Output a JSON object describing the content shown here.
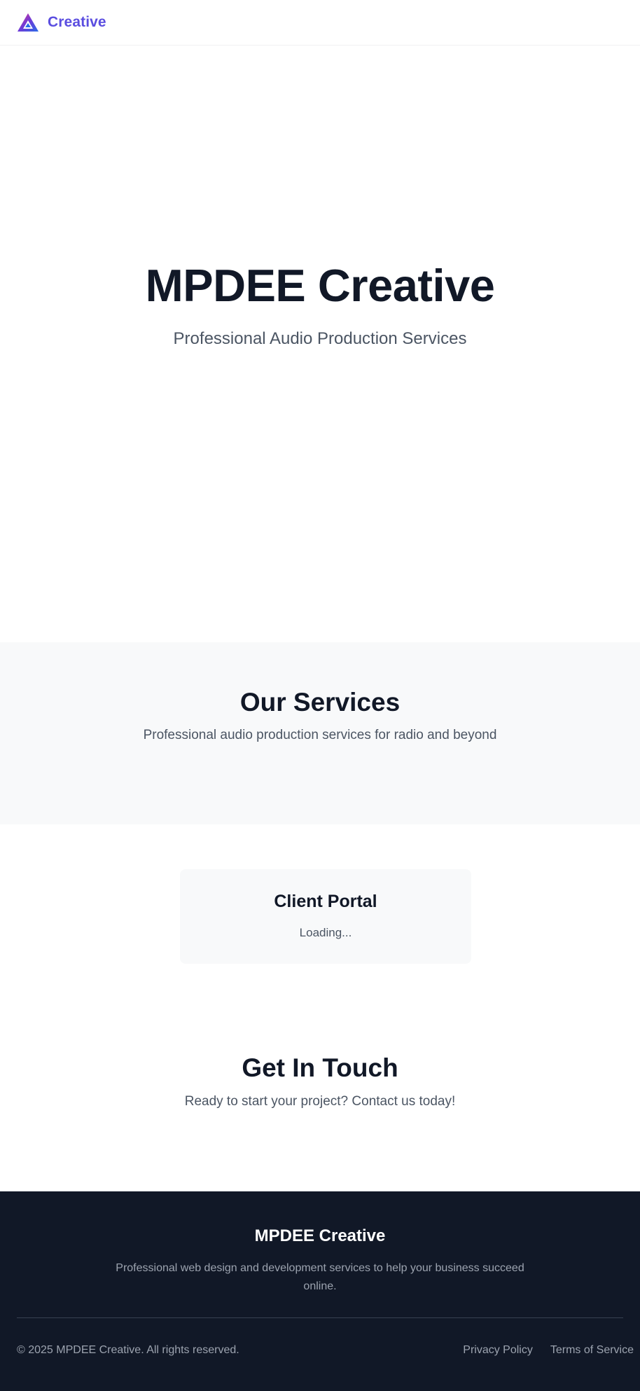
{
  "header": {
    "logo_text": "Creative",
    "logo_icon": "triangle-logo-icon",
    "brand_gradient": [
      "#e0338f",
      "#6d3bd8",
      "#2a6be8"
    ]
  },
  "hero": {
    "title": "MPDEE Creative",
    "subtitle": "Professional Audio Production Services"
  },
  "services": {
    "title": "Our Services",
    "subtitle": "Professional audio production services for radio and beyond"
  },
  "portal": {
    "title": "Client Portal",
    "status": "Loading..."
  },
  "contact": {
    "title": "Get In Touch",
    "subtitle": "Ready to start your project? Contact us today!"
  },
  "footer": {
    "brand": "MPDEE Creative",
    "description": "Professional web design and development services to help your business succeed online.",
    "copyright": "© 2025 MPDEE Creative. All rights reserved.",
    "links": [
      "Privacy Policy",
      "Terms of Service"
    ]
  },
  "colors": {
    "dark": "#111827",
    "muted": "#4b5563",
    "section_bg": "#f8f9fa",
    "footer_text": "#9ca3af"
  }
}
